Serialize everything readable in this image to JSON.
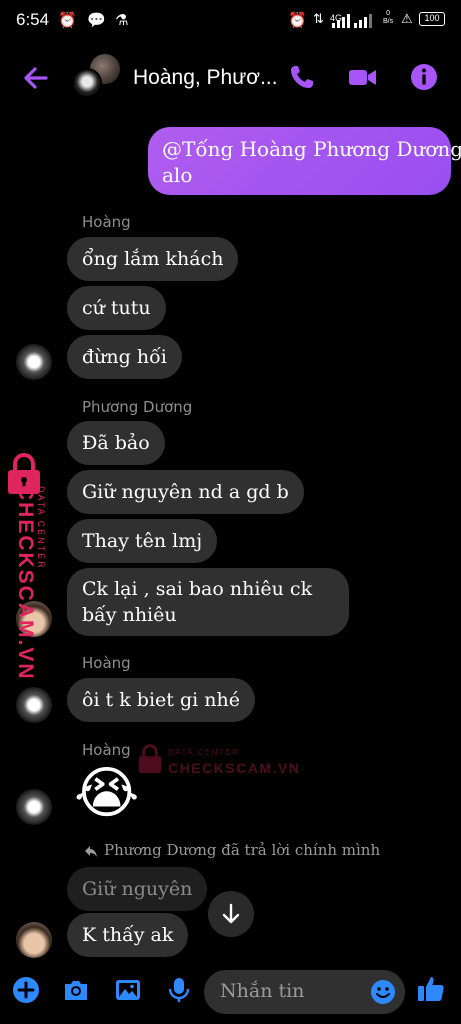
{
  "status_bar": {
    "time": "6:54",
    "network_type": "4G",
    "net_speed_value": "0",
    "net_speed_unit": "B/s",
    "battery": "100"
  },
  "header": {
    "title": "Hoàng, Phươ..."
  },
  "accent_color": "#a855f7",
  "messages": {
    "outgoing": {
      "mention": "@Tống Hoàng Phương Dương",
      "text": "alo"
    },
    "group1": {
      "sender": "Hoàng",
      "items": [
        "ổng lắm khách",
        "cứ tutu",
        "đừng hối"
      ]
    },
    "group2": {
      "sender": "Phương Dương",
      "items": [
        "Đã bảo",
        "Giữ nguyên nd a gd b",
        "Thay tên lmj",
        "Ck lại , sai bao nhiêu ck bấy nhiêu"
      ]
    },
    "group3": {
      "sender": "Hoàng",
      "items": [
        "ôi t k biet gi nhé"
      ]
    },
    "group4": {
      "sender": "Hoàng",
      "emoji": "😭"
    },
    "reply": {
      "note": "Phương Dương đã trả lời chính mình",
      "quoted": "Giữ nguyên",
      "text": "K thấy ak"
    }
  },
  "watermark": {
    "label_small": "DATA CENTER",
    "label_big": "CHECKSCAM.VN"
  },
  "composer": {
    "placeholder": "Nhắn tin"
  }
}
